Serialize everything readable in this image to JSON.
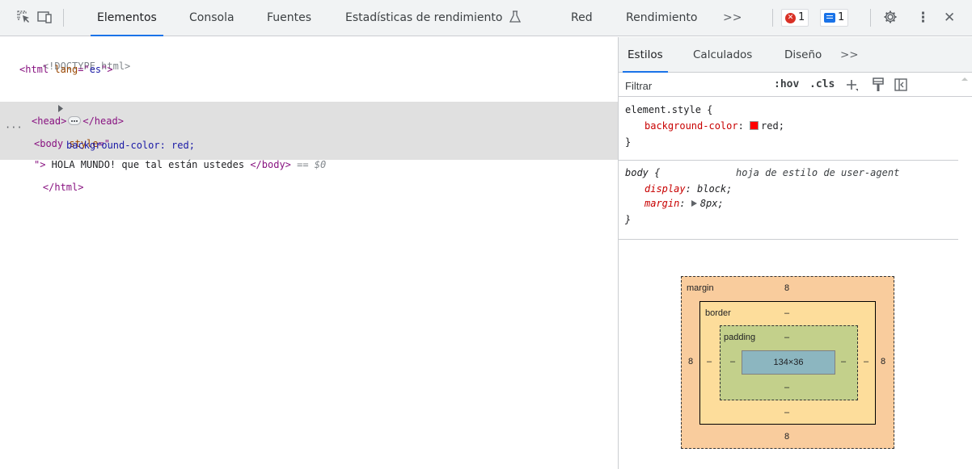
{
  "toolbar": {
    "tabs": [
      {
        "label": "Elementos"
      },
      {
        "label": "Consola"
      },
      {
        "label": "Fuentes"
      },
      {
        "label": "Estadísticas de rendimiento"
      },
      {
        "label": "Red"
      },
      {
        "label": "Rendimiento"
      }
    ],
    "more": ">>",
    "errors_count": "1",
    "messages_count": "1",
    "more_menu": "⋮",
    "close": "✕"
  },
  "dom": {
    "doctype": "<!DOCTYPE html>",
    "html_open_tag": "<html",
    "html_lang_attr": " lang",
    "html_lang_eq": "=\"",
    "html_lang_val": "es",
    "html_lang_close": "\">",
    "head_open": "<head>",
    "head_close": "</head>",
    "body_open_tag": "<body",
    "body_style_attr": " style",
    "body_style_eq": "=\"",
    "body_style_val": "background-color: red;",
    "body_close_quote": "\">",
    "body_text": " HOLA MUNDO! que tal están ustedes ",
    "body_close": "</body>",
    "selected_marker": " == $0",
    "html_close": "</html>",
    "ellipsis_marker": "···"
  },
  "styles": {
    "tabs": [
      {
        "label": "Estilos"
      },
      {
        "label": "Calculados"
      },
      {
        "label": "Diseño"
      }
    ],
    "more": ">>",
    "filter_placeholder": "Filtrar",
    "hov": ":hov",
    "cls": ".cls",
    "element_style_selector": "element.style {",
    "element_style_prop": "background-color",
    "element_style_val": "red;",
    "close_brace": "}",
    "ua_selector": "body {",
    "ua_source": "hoja de estilo de user-agent",
    "ua_prop1": "display",
    "ua_val1": "block;",
    "ua_prop2": "margin",
    "ua_val2": "8px;",
    "swatch_color": "#ff0000"
  },
  "box_model": {
    "margin_label": "margin",
    "margin_top": "8",
    "margin_bottom": "8",
    "margin_left": "8",
    "margin_right": "8",
    "border_label": "border",
    "border_top": "–",
    "border_bottom": "–",
    "border_left": "–",
    "border_right": "–",
    "padding_label": "padding",
    "padding_top": "–",
    "padding_bottom": "–",
    "padding_left": "–",
    "padding_right": "–",
    "content_size": "134×36"
  }
}
